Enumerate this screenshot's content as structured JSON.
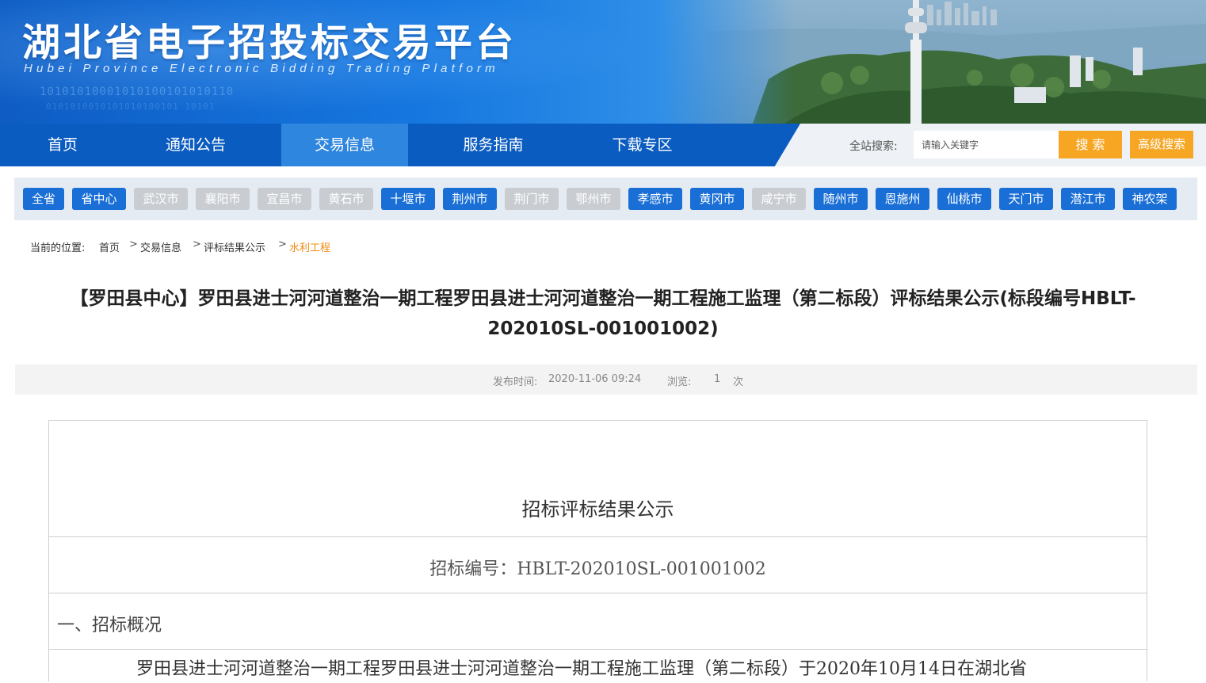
{
  "banner": {
    "title_cn": "湖北省电子招投标交易平台",
    "title_en": "Hubei Province Electronic Bidding Trading Platform",
    "binary_line_1": "10101010001010100101010110",
    "binary_line_2": "0101010010101010100101  10101"
  },
  "nav": {
    "items": [
      {
        "label": "首页"
      },
      {
        "label": "通知公告"
      },
      {
        "label": "交易信息"
      },
      {
        "label": "服务指南"
      },
      {
        "label": "下载专区"
      }
    ],
    "active_index": 2,
    "search_label": "全站搜索:",
    "search_placeholder": "请输入关键字",
    "search_button": "搜 索",
    "advanced_button": "高级搜索"
  },
  "cities": [
    {
      "label": "全省",
      "enabled": true
    },
    {
      "label": "省中心",
      "enabled": true
    },
    {
      "label": "武汉市",
      "enabled": false
    },
    {
      "label": "襄阳市",
      "enabled": false
    },
    {
      "label": "宜昌市",
      "enabled": false
    },
    {
      "label": "黄石市",
      "enabled": false
    },
    {
      "label": "十堰市",
      "enabled": true
    },
    {
      "label": "荆州市",
      "enabled": true
    },
    {
      "label": "荆门市",
      "enabled": false
    },
    {
      "label": "鄂州市",
      "enabled": false
    },
    {
      "label": "孝感市",
      "enabled": true
    },
    {
      "label": "黄冈市",
      "enabled": true
    },
    {
      "label": "咸宁市",
      "enabled": false
    },
    {
      "label": "随州市",
      "enabled": true
    },
    {
      "label": "恩施州",
      "enabled": true
    },
    {
      "label": "仙桃市",
      "enabled": true
    },
    {
      "label": "天门市",
      "enabled": true
    },
    {
      "label": "潜江市",
      "enabled": true
    },
    {
      "label": "神农架",
      "enabled": true
    }
  ],
  "breadcrumb": {
    "prefix": "当前的位置:",
    "items": [
      "首页",
      "交易信息",
      "评标结果公示",
      "水利工程"
    ],
    "separator": ">"
  },
  "article": {
    "title_line_1": "【罗田县中心】罗田县进士河河道整治一期工程罗田县进士河河道整治一期工程施工监理（第二标段）评标结果公示(标段编号HBLT-",
    "title_line_2": "202010SL-001001002)",
    "publish_label": "发布时间:",
    "publish_time": "2020-11-06 09:24",
    "views_label": "浏览:",
    "views_count": "1",
    "views_unit": "次"
  },
  "document": {
    "heading": "招标评标结果公示",
    "bid_number": "招标编号：HBLT-202010SL-001001002",
    "section_1": "一、招标概况",
    "paragraph_1": "罗田县进士河河道整治一期工程罗田县进士河河道整治一期工程施工监理（第二标段）于2020年10月14日在湖北省"
  },
  "colors": {
    "nav_blue": "#0b5cc0",
    "nav_active": "#2e86de",
    "accent_orange": "#f6a623",
    "tag_on": "#1a6fd6",
    "tag_off": "#c9cdd2",
    "crumb_current": "#f08a0c"
  }
}
